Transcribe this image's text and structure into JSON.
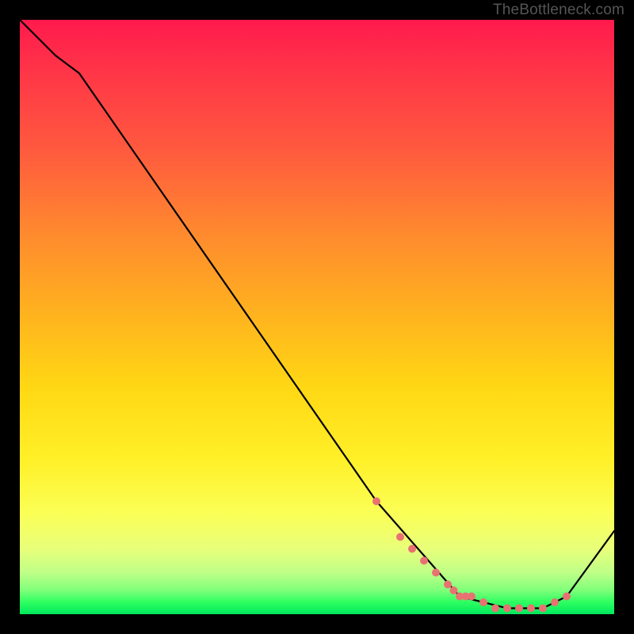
{
  "watermark": "TheBottleneck.com",
  "chart_data": {
    "type": "line",
    "title": "",
    "xlabel": "",
    "ylabel": "",
    "xlim": [
      0,
      100
    ],
    "ylim": [
      0,
      100
    ],
    "series": [
      {
        "name": "curve",
        "x": [
          0,
          6,
          10,
          60,
          74,
          82,
          88,
          92,
          100
        ],
        "values": [
          100,
          94,
          91,
          19,
          3,
          1,
          1,
          3,
          14
        ]
      }
    ],
    "markers": {
      "name": "highlighted-points",
      "color": "#e87272",
      "x": [
        60,
        64,
        66,
        68,
        70,
        72,
        73,
        74,
        75,
        76,
        78,
        80,
        82,
        84,
        86,
        88,
        90,
        92
      ],
      "values": [
        19,
        13,
        11,
        9,
        7,
        5,
        4,
        3,
        3,
        3,
        2,
        1,
        1,
        1,
        1,
        1,
        2,
        3
      ]
    }
  }
}
